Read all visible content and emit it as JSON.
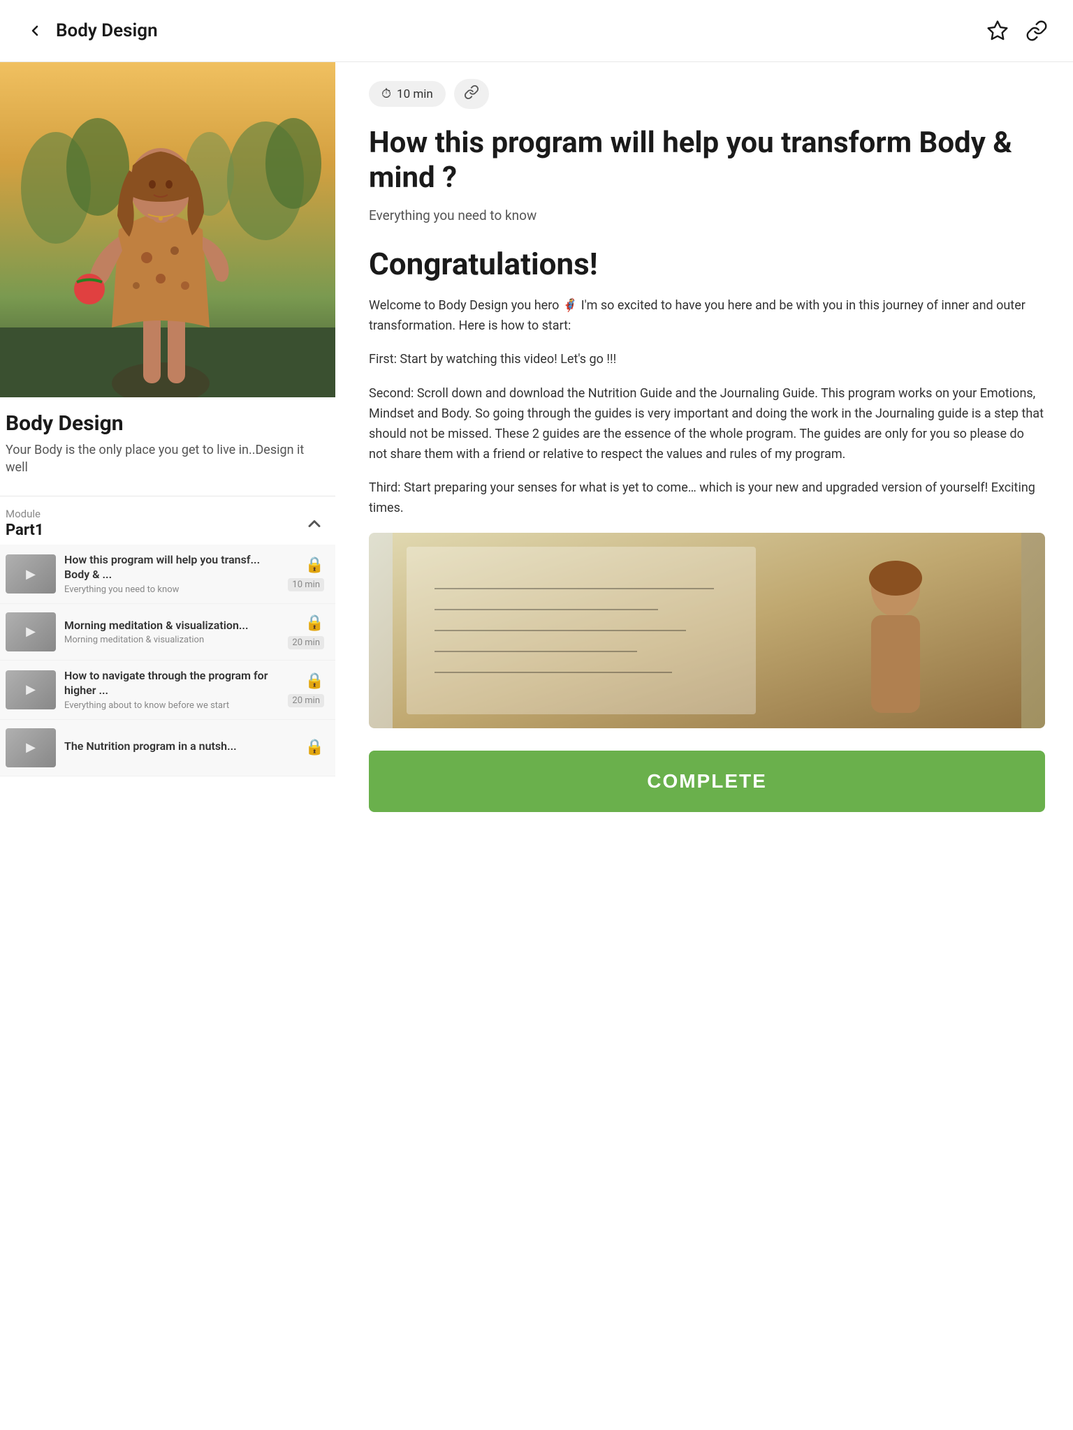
{
  "header": {
    "back_label": "Body Design",
    "bookmark_icon": "★",
    "share_icon": "⛓"
  },
  "left_panel": {
    "hero_alt": "Woman holding fruit in tropical setting",
    "program_title": "Body Design",
    "program_subtitle": "Your Body is the only place you get to live in..Design it well",
    "module": {
      "label": "Module",
      "name": "Part1"
    },
    "lessons": [
      {
        "title": "How this program will help you transf... Body & ...",
        "desc": "Everything you need to know",
        "duration": "10 min",
        "locked": true
      },
      {
        "title": "Morning meditation & visualization...",
        "desc": "Morning meditation & visualization",
        "duration": "20 min",
        "locked": true
      },
      {
        "title": "How to navigate through the program for higher ...",
        "desc": "Everything about to know before we start",
        "duration": "20 min",
        "locked": true
      },
      {
        "title": "The Nutrition program in a nutsh...",
        "desc": "",
        "duration": "",
        "locked": true
      }
    ]
  },
  "right_panel": {
    "duration": "10 min",
    "duration_icon": "⏱",
    "link_icon": "⛓",
    "article_title": "How this program will help you transform Body & mind ?",
    "article_tagline": "Everything you need to know",
    "congrats_title": "Congratulations!",
    "body_paragraphs": [
      "Welcome to Body Design you hero 🦸 I'm so excited to have you here and be with you in this journey of inner and outer transformation. Here is how to start:",
      "First: Start by watching this video! Let's go !!!",
      "Second: Scroll down and download the Nutrition Guide and the Journaling Guide. This program works on your Emotions, Mindset and Body. So going through the guides is very important and doing the work in the Journaling guide is a step that should not be missed. These 2 guides are the essence of the whole program. The guides are only for you so please do not share them with a friend or relative to respect the values and rules of my program.",
      "Third: Start preparing your senses for what is yet to come… which is your new and upgraded version of yourself! Exciting times."
    ],
    "complete_button_label": "COMPLETE"
  }
}
